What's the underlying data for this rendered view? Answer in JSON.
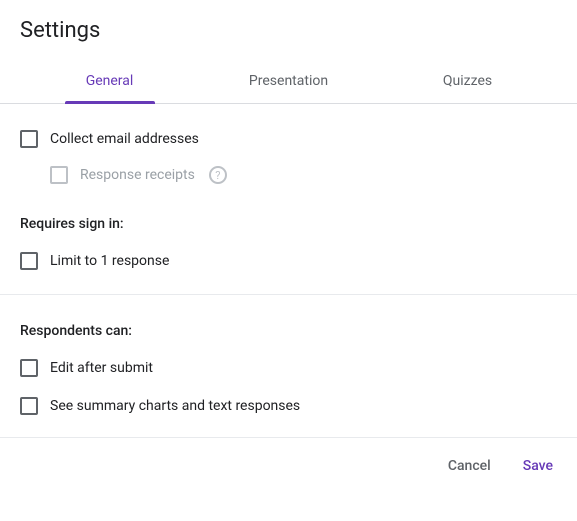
{
  "title": "Settings",
  "tabs": {
    "general": "General",
    "presentation": "Presentation",
    "quizzes": "Quizzes"
  },
  "options": {
    "collect_email": "Collect email addresses",
    "response_receipts": "Response receipts",
    "limit_one": "Limit to 1 response",
    "edit_after": "Edit after submit",
    "see_summary": "See summary charts and text responses"
  },
  "sections": {
    "requires_signin": "Requires sign in:",
    "respondents_can": "Respondents can:"
  },
  "actions": {
    "cancel": "Cancel",
    "save": "Save"
  }
}
